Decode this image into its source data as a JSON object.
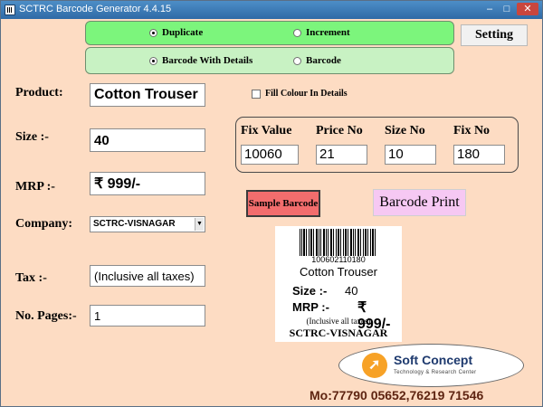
{
  "window": {
    "title": "SCTRC Barcode Generator 4.4.15",
    "controls": {
      "minimize": "–",
      "maximize": "□",
      "close": "✕"
    }
  },
  "mode": {
    "options": [
      {
        "label": "Duplicate",
        "selected": true
      },
      {
        "label": "Increment",
        "selected": false
      }
    ]
  },
  "format": {
    "options": [
      {
        "label": "Barcode With Details",
        "selected": true
      },
      {
        "label": "Barcode",
        "selected": false
      }
    ]
  },
  "buttons": {
    "setting": "Setting",
    "sample": "Sample Barcode",
    "print": "Barcode Print"
  },
  "form": {
    "product": {
      "label": "Product:",
      "value": "Cotton Trouser"
    },
    "size": {
      "label": "Size :-",
      "value": "40"
    },
    "mrp": {
      "label": "MRP :-",
      "value": "₹ 999/-"
    },
    "company": {
      "label": "Company:",
      "value": "SCTRC-VISNAGAR"
    },
    "tax": {
      "label": "Tax :-",
      "value": "(Inclusive all taxes)"
    },
    "pages": {
      "label": "No. Pages:-",
      "value": "1"
    }
  },
  "fill_colour": {
    "label": "Fill Colour In Details",
    "checked": false
  },
  "fix_group": {
    "columns": [
      {
        "label": "Fix Value",
        "value": "10060"
      },
      {
        "label": "Price No",
        "value": "21"
      },
      {
        "label": "Size No",
        "value": "10"
      },
      {
        "label": "Fix No",
        "value": "180"
      }
    ]
  },
  "preview": {
    "barcode_number": "100602110180",
    "product": "Cotton Trouser",
    "size_label": "Size :-",
    "size_value": "40",
    "mrp_label": "MRP :-",
    "mrp_value": "₹ 999/-",
    "tax": "(Inclusive all taxes)",
    "company": "SCTRC-VISNAGAR"
  },
  "logo": {
    "title": "Soft Concept",
    "subtitle": "Technology & Research Center"
  },
  "contact": "Mo:77790 05652,76219 71546",
  "colors": {
    "background": "#fddcc3",
    "mode_panel": "#7cf57c",
    "format_panel": "#c8f2c3",
    "sample_button": "#f26d6d",
    "print_button": "#f6c8f3"
  }
}
